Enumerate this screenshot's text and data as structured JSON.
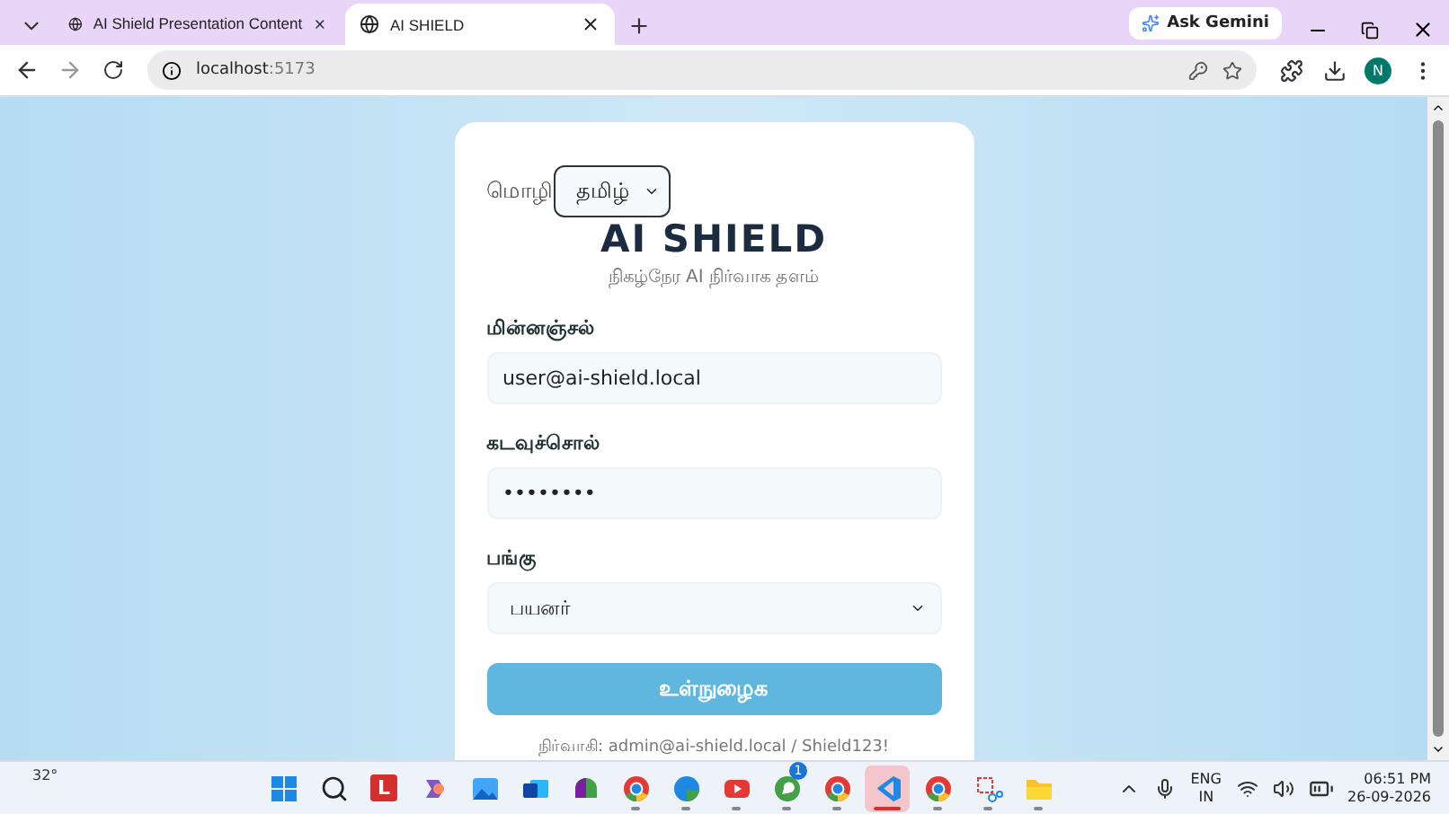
{
  "browser": {
    "tabs": [
      {
        "title": "AI Shield Presentation Content",
        "selected": false
      },
      {
        "title": "AI SHIELD",
        "selected": true
      }
    ],
    "ask_gemini": "Ask Gemini",
    "address_host": "localhost",
    "address_port": ":5173",
    "profile": "N"
  },
  "page": {
    "language_label": "மொழி",
    "language_value": "தமிழ்",
    "title": "AI SHIELD",
    "subtitle": "நிகழ்நேர AI நிர்வாக தளம்",
    "fields": [
      {
        "kind": "input",
        "label": "மின்னஞ்சல்",
        "value": "user@ai-shield.local"
      },
      {
        "kind": "input",
        "label": "கடவுச்சொல்",
        "value": "••••••••"
      },
      {
        "kind": "select",
        "label": "பங்கு",
        "value": "பயனர்"
      }
    ],
    "submit": "உள்நுழைக",
    "hint": "நிர்வாகி: admin@ai-shield.local / Shield123!"
  },
  "taskbar": {
    "weather": "32°",
    "apps": [
      {
        "kind": "windows",
        "running": false,
        "selected": false
      },
      {
        "kind": "search",
        "running": false,
        "selected": false
      },
      {
        "kind": "letter",
        "label": "L",
        "running": false,
        "selected": false
      },
      {
        "kind": "copilot",
        "running": false,
        "selected": false
      },
      {
        "kind": "photos",
        "running": false,
        "selected": false
      },
      {
        "kind": "outlook",
        "running": false,
        "selected": false
      },
      {
        "kind": "m365",
        "running": false,
        "selected": false
      },
      {
        "kind": "chrome",
        "running": true,
        "selected": false
      },
      {
        "kind": "edge",
        "running": true,
        "selected": false
      },
      {
        "kind": "youtube",
        "running": true,
        "selected": false
      },
      {
        "kind": "whatsapp",
        "badge": "1",
        "running": true,
        "selected": false
      },
      {
        "kind": "chrome",
        "running": true,
        "selected": false
      },
      {
        "kind": "vscode",
        "running": true,
        "selected": true
      },
      {
        "kind": "chrome",
        "running": true,
        "selected": false
      },
      {
        "kind": "snip",
        "running": true,
        "selected": false
      },
      {
        "kind": "folder",
        "running": true,
        "selected": false
      }
    ],
    "language": "ENG",
    "region": "IN",
    "time": "06:51 PM",
    "date": "26-09-2026"
  }
}
